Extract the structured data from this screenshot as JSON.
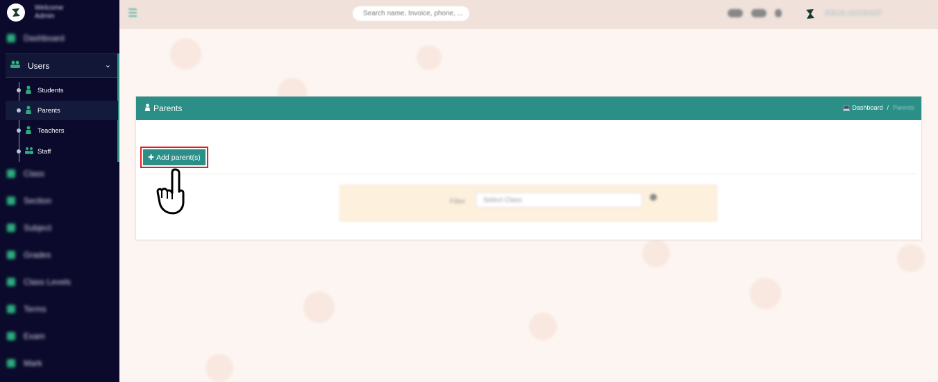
{
  "sidebar": {
    "brand_line1": "Welcome",
    "brand_line2": "Admin",
    "users_label": "Users",
    "sub_items": [
      {
        "label": "Students"
      },
      {
        "label": "Parents"
      },
      {
        "label": "Teachers"
      },
      {
        "label": "Staff"
      }
    ],
    "blurred_items": [
      "Dashboard",
      "Class",
      "Section",
      "Subject",
      "Grades",
      "Class Levels",
      "Terms",
      "Exam",
      "Mark"
    ]
  },
  "header": {
    "search_placeholder": "Search name, Invoice, phone, ...",
    "account_label": "DEMO ACCOUNT"
  },
  "panel": {
    "title": "Parents",
    "breadcrumb_home": "Dashboard",
    "breadcrumb_sep": "/",
    "breadcrumb_current": "Parents",
    "add_button_label": "Add parent(s)",
    "filter_label": "Filter",
    "filter_select_value": "Select Class"
  },
  "colors": {
    "sidebar_bg": "#0b0a2c",
    "accent": "#2b8f88",
    "highlight": "#e3201f"
  },
  "icons": [
    "gear-icon",
    "users-icon",
    "chevron-down-icon",
    "student-icon",
    "parent-icon",
    "teacher-icon",
    "staff-icon",
    "menu-icon",
    "plus-icon",
    "laptop-icon",
    "pointing-hand-icon"
  ]
}
